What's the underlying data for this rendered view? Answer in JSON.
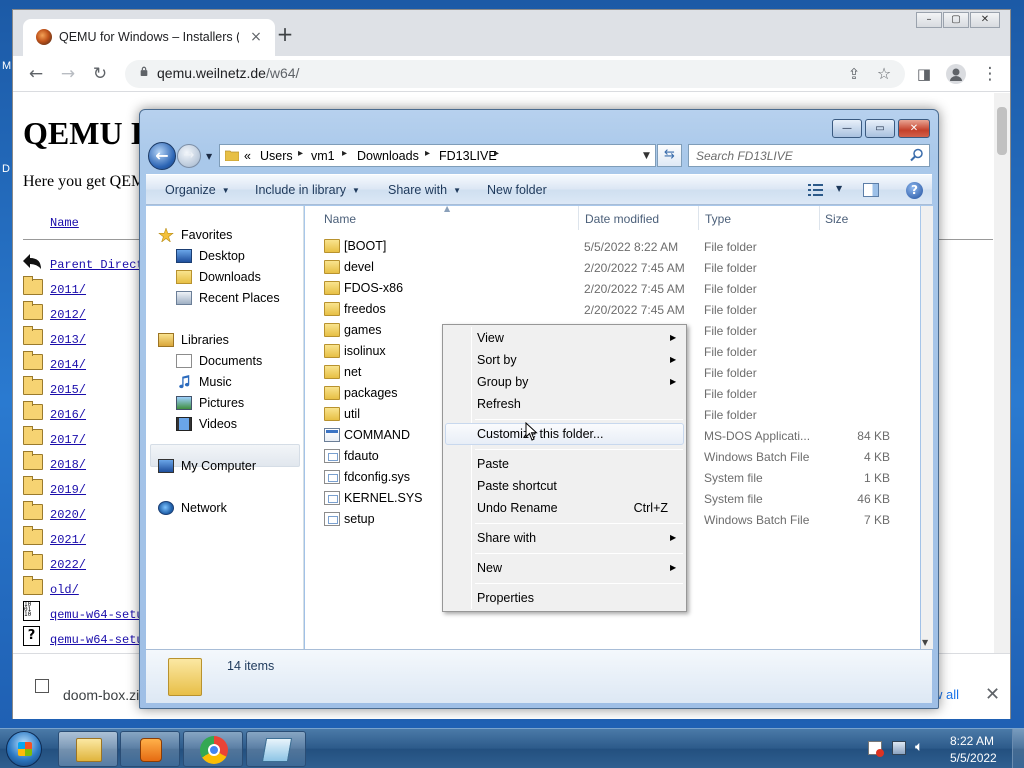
{
  "desktop": {
    "side_letter_1": "M",
    "side_letter_2": "D"
  },
  "browser": {
    "tab_title": "QEMU for Windows – Installers (",
    "tab_close": "×",
    "new_tab": "+",
    "url_host": "qemu.weilnetz.de",
    "url_path": "/w64/",
    "window_controls": [
      "–",
      "▢",
      "✕"
    ]
  },
  "webpage": {
    "heading": "QEMU I",
    "intro": "Here you get QEM",
    "column_name": "Name",
    "entries": [
      {
        "label": "Parent Direct",
        "icon": "back-arrow-icon"
      },
      {
        "label": "2011/",
        "icon": "folder-icon"
      },
      {
        "label": "2012/",
        "icon": "folder-icon"
      },
      {
        "label": "2013/",
        "icon": "folder-icon"
      },
      {
        "label": "2014/",
        "icon": "folder-icon"
      },
      {
        "label": "2015/",
        "icon": "folder-icon"
      },
      {
        "label": "2016/",
        "icon": "folder-icon"
      },
      {
        "label": "2017/",
        "icon": "folder-icon"
      },
      {
        "label": "2018/",
        "icon": "folder-icon"
      },
      {
        "label": "2019/",
        "icon": "folder-icon"
      },
      {
        "label": "2020/",
        "icon": "folder-icon"
      },
      {
        "label": "2021/",
        "icon": "folder-icon"
      },
      {
        "label": "2022/",
        "icon": "folder-icon"
      },
      {
        "label": "old/",
        "icon": "folder-icon"
      },
      {
        "label": "qemu-w64-setu",
        "icon": "binary-icon"
      },
      {
        "label": "qemu-w64-setu",
        "icon": "unknown-file-icon"
      }
    ]
  },
  "downloads_bar": {
    "file_name": "doom-box.zip",
    "show_all": "w all",
    "close": "✕"
  },
  "explorer": {
    "window_controls": [
      "—",
      "▭",
      "✕"
    ],
    "breadcrumb": [
      "«",
      "Users",
      "vm1",
      "Downloads",
      "FD13LIVE"
    ],
    "search_placeholder": "Search FD13LIVE",
    "commands": [
      "Organize",
      "Include in library",
      "Share with",
      "New folder"
    ],
    "help": "?",
    "nav": {
      "favorites": "Favorites",
      "favorites_items": [
        "Desktop",
        "Downloads",
        "Recent Places"
      ],
      "libraries": "Libraries",
      "libraries_items": [
        "Documents",
        "Music",
        "Pictures",
        "Videos"
      ],
      "my_computer": "My Computer",
      "network": "Network"
    },
    "columns": {
      "name": "Name",
      "date": "Date modified",
      "type": "Type",
      "size": "Size"
    },
    "files": [
      {
        "name": "[BOOT]",
        "date": "5/5/2022 8:22 AM",
        "type": "File folder",
        "size": "",
        "kind": "folder"
      },
      {
        "name": "devel",
        "date": "2/20/2022 7:45 AM",
        "type": "File folder",
        "size": "",
        "kind": "folder"
      },
      {
        "name": "FDOS-x86",
        "date": "2/20/2022 7:45 AM",
        "type": "File folder",
        "size": "",
        "kind": "folder"
      },
      {
        "name": "freedos",
        "date": "2/20/2022 7:45 AM",
        "type": "File folder",
        "size": "",
        "kind": "folder"
      },
      {
        "name": "games",
        "date": "",
        "type": "File folder",
        "size": "",
        "kind": "folder"
      },
      {
        "name": "isolinux",
        "date": "",
        "type": "File folder",
        "size": "",
        "kind": "folder"
      },
      {
        "name": "net",
        "date": "",
        "type": "File folder",
        "size": "",
        "kind": "folder"
      },
      {
        "name": "packages",
        "date": "",
        "type": "File folder",
        "size": "",
        "kind": "folder"
      },
      {
        "name": "util",
        "date": "",
        "type": "File folder",
        "size": "",
        "kind": "folder"
      },
      {
        "name": "COMMAND",
        "date": "",
        "type": "MS-DOS Applicati...",
        "size": "84 KB",
        "kind": "app"
      },
      {
        "name": "fdauto",
        "date": "",
        "type": "Windows Batch File",
        "size": "4 KB",
        "kind": "file"
      },
      {
        "name": "fdconfig.sys",
        "date": "",
        "type": "System file",
        "size": "1 KB",
        "kind": "file"
      },
      {
        "name": "KERNEL.SYS",
        "date": "",
        "type": "System file",
        "size": "46 KB",
        "kind": "file"
      },
      {
        "name": "setup",
        "date": "",
        "type": "Windows Batch File",
        "size": "7 KB",
        "kind": "file"
      }
    ],
    "item_count": "14 items"
  },
  "context_menu": {
    "view": "View",
    "sort_by": "Sort by",
    "group_by": "Group by",
    "refresh": "Refresh",
    "customize": "Customize this folder...",
    "paste": "Paste",
    "paste_shortcut": "Paste shortcut",
    "undo_rename": "Undo Rename",
    "undo_shortcut": "Ctrl+Z",
    "share_with": "Share with",
    "new": "New",
    "properties": "Properties"
  },
  "taskbar": {
    "time": "8:22 AM",
    "date": "5/5/2022"
  },
  "colors": {
    "link": "#1a0dab",
    "explorer_frame": "#a9c8ea",
    "taskbar": "#2c5a8a"
  }
}
